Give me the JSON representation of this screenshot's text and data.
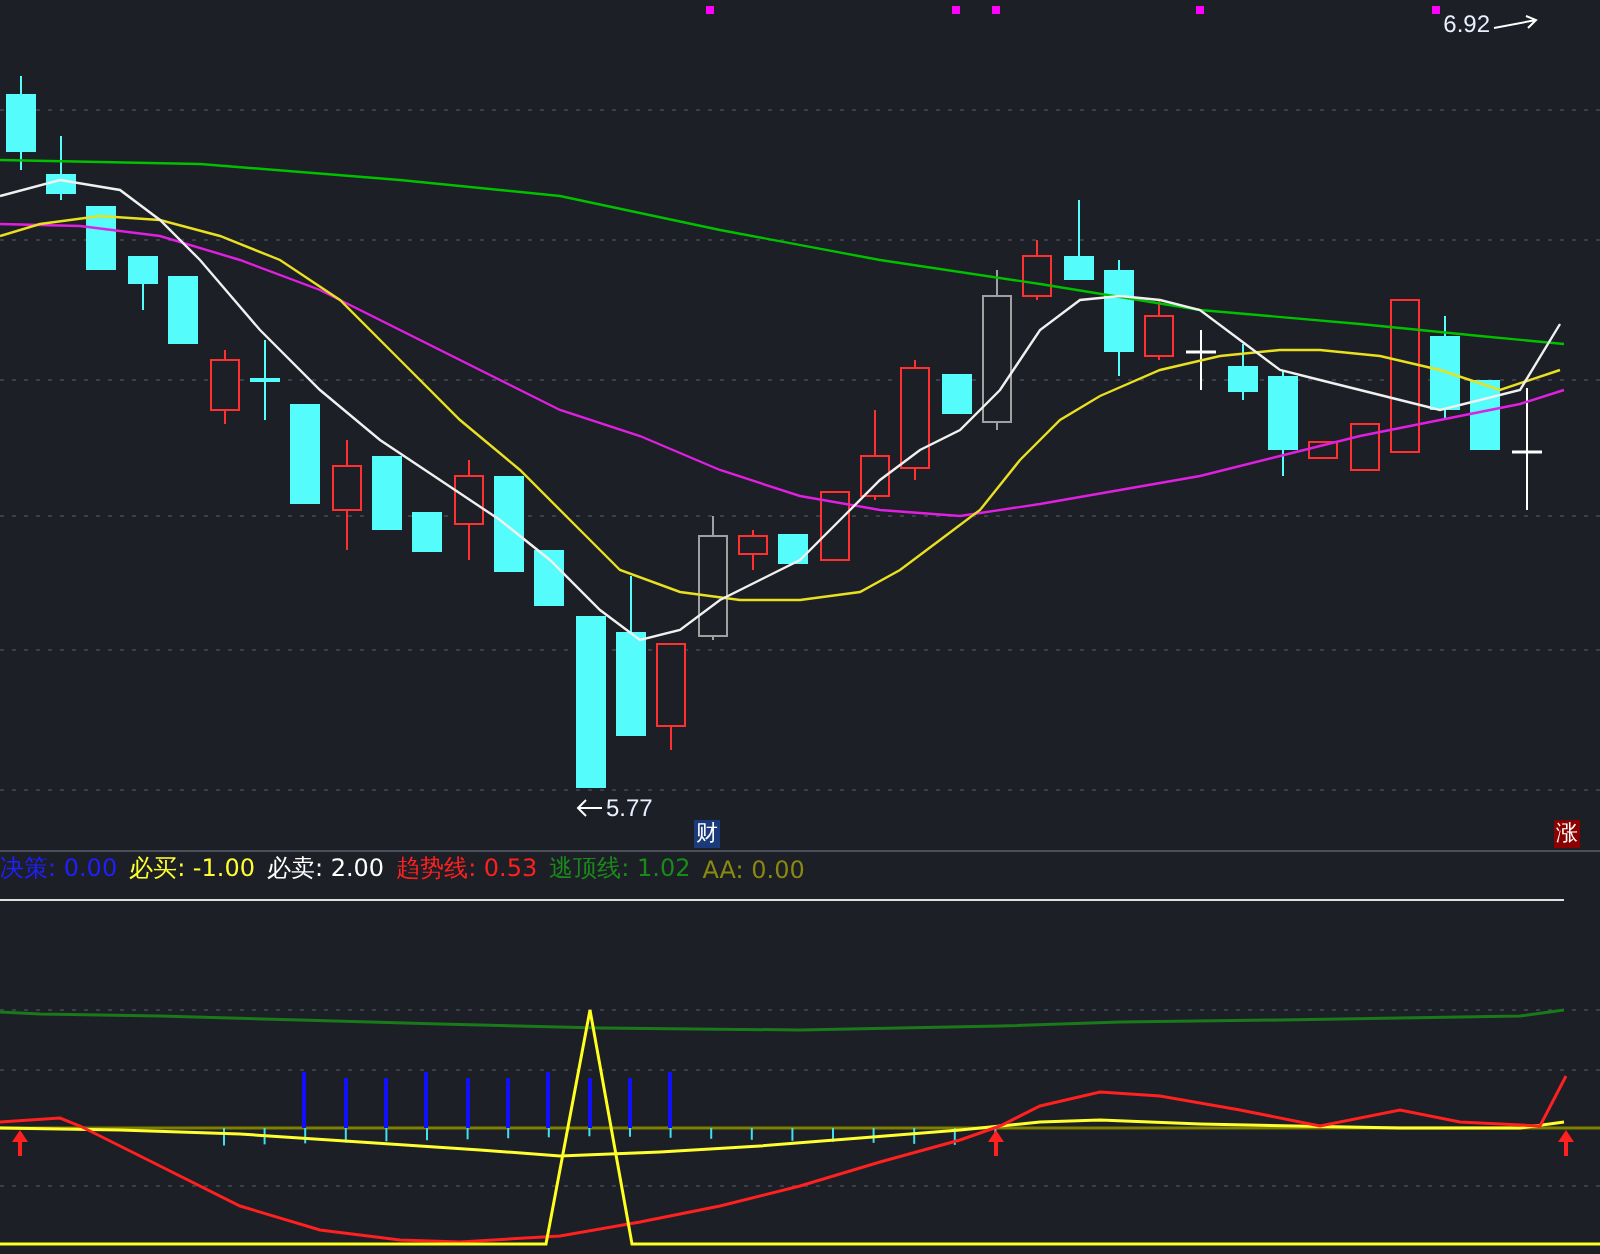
{
  "price_labels": [
    {
      "kind": "high",
      "text": "6.92"
    },
    {
      "kind": "low",
      "text": "5.77"
    }
  ],
  "badges": [
    {
      "text": "财",
      "color": "#1a3a7a"
    },
    {
      "text": "涨",
      "color": "#8b0000"
    }
  ],
  "legend": [
    {
      "text": "决策: 0.00",
      "color": "#2020ff"
    },
    {
      "text": "必买: -1.00",
      "color": "#ffff30"
    },
    {
      "text": "必卖: 2.00",
      "color": "#ffffff"
    },
    {
      "text": "趋势线: 0.53",
      "color": "#ff2020"
    },
    {
      "text": "逃顶线: 1.02",
      "color": "#1a8a1a"
    },
    {
      "text": "AA: 0.00",
      "color": "#8a8a10"
    }
  ]
}
